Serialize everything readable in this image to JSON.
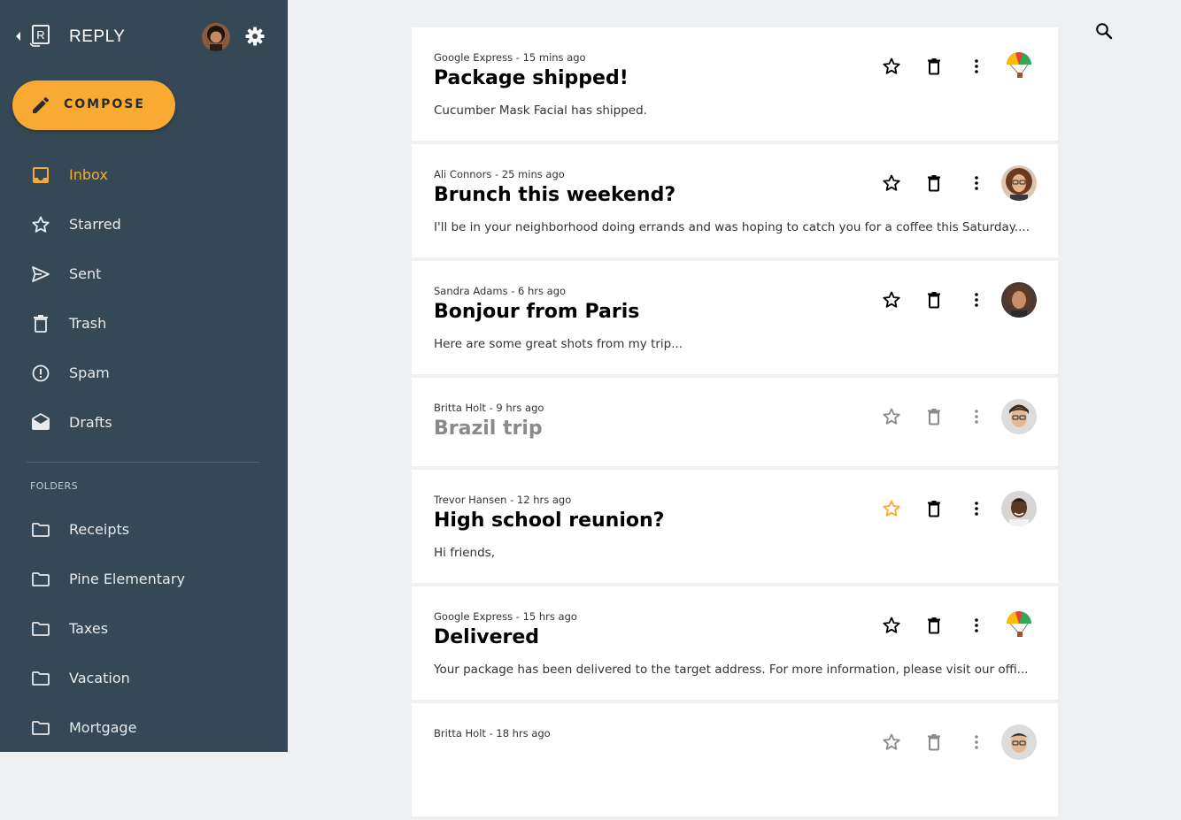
{
  "app": {
    "name": "REPLY"
  },
  "sidebar": {
    "compose_label": "COMPOSE",
    "nav": [
      {
        "label": "Inbox",
        "icon": "inbox-icon",
        "active": true
      },
      {
        "label": "Starred",
        "icon": "star-icon"
      },
      {
        "label": "Sent",
        "icon": "send-icon"
      },
      {
        "label": "Trash",
        "icon": "trash-icon"
      },
      {
        "label": "Spam",
        "icon": "spam-icon"
      },
      {
        "label": "Drafts",
        "icon": "drafts-icon"
      }
    ],
    "folders_heading": "FOLDERS",
    "folders": [
      {
        "label": "Receipts"
      },
      {
        "label": "Pine Elementary"
      },
      {
        "label": "Taxes"
      },
      {
        "label": "Vacation"
      },
      {
        "label": "Mortgage"
      }
    ]
  },
  "emails": [
    {
      "sender": "Google Express",
      "time": "15 mins ago",
      "meta": "Google Express - 15 mins ago",
      "subject": "Package shipped!",
      "preview": "Cucumber Mask Facial has shipped.",
      "read": false,
      "starred": false,
      "avatar": "google-express-avatar"
    },
    {
      "sender": "Ali Connors",
      "time": "25 mins ago",
      "meta": "Ali Connors - 25 mins ago",
      "subject": "Brunch this weekend?",
      "preview": "I'll be in your neighborhood doing errands and was hoping to catch you for a coffee this Saturday....",
      "read": false,
      "starred": false,
      "avatar": "ali-connors-avatar"
    },
    {
      "sender": "Sandra Adams",
      "time": "6 hrs ago",
      "meta": "Sandra Adams - 6 hrs ago",
      "subject": "Bonjour from Paris",
      "preview": "Here are some great shots from my trip...",
      "read": false,
      "starred": false,
      "avatar": "sandra-adams-avatar"
    },
    {
      "sender": "Britta Holt",
      "time": "9 hrs ago",
      "meta": "Britta Holt - 9 hrs ago",
      "subject": "Brazil trip",
      "preview": "",
      "read": true,
      "starred": false,
      "avatar": "britta-holt-avatar"
    },
    {
      "sender": "Trevor Hansen",
      "time": "12 hrs ago",
      "meta": "Trevor Hansen - 12 hrs ago",
      "subject": "High school reunion?",
      "preview": "Hi friends,",
      "read": false,
      "starred": true,
      "avatar": "trevor-hansen-avatar"
    },
    {
      "sender": "Google Express",
      "time": "15 hrs ago",
      "meta": "Google Express - 15 hrs ago",
      "subject": "Delivered",
      "preview": "Your package has been delivered to the target address. For more information, please visit our offi...",
      "read": false,
      "starred": false,
      "avatar": "google-express-avatar"
    },
    {
      "sender": "Britta Holt",
      "time": "18 hrs ago",
      "meta": "Britta Holt - 18 hrs ago",
      "subject": "",
      "preview": "",
      "read": true,
      "starred": false,
      "avatar": "britta-holt-avatar"
    }
  ],
  "colors": {
    "sidebar_bg": "#344955",
    "accent": "#f9aa33",
    "page_bg": "#eff0f2",
    "card_bg": "#ffffff"
  }
}
